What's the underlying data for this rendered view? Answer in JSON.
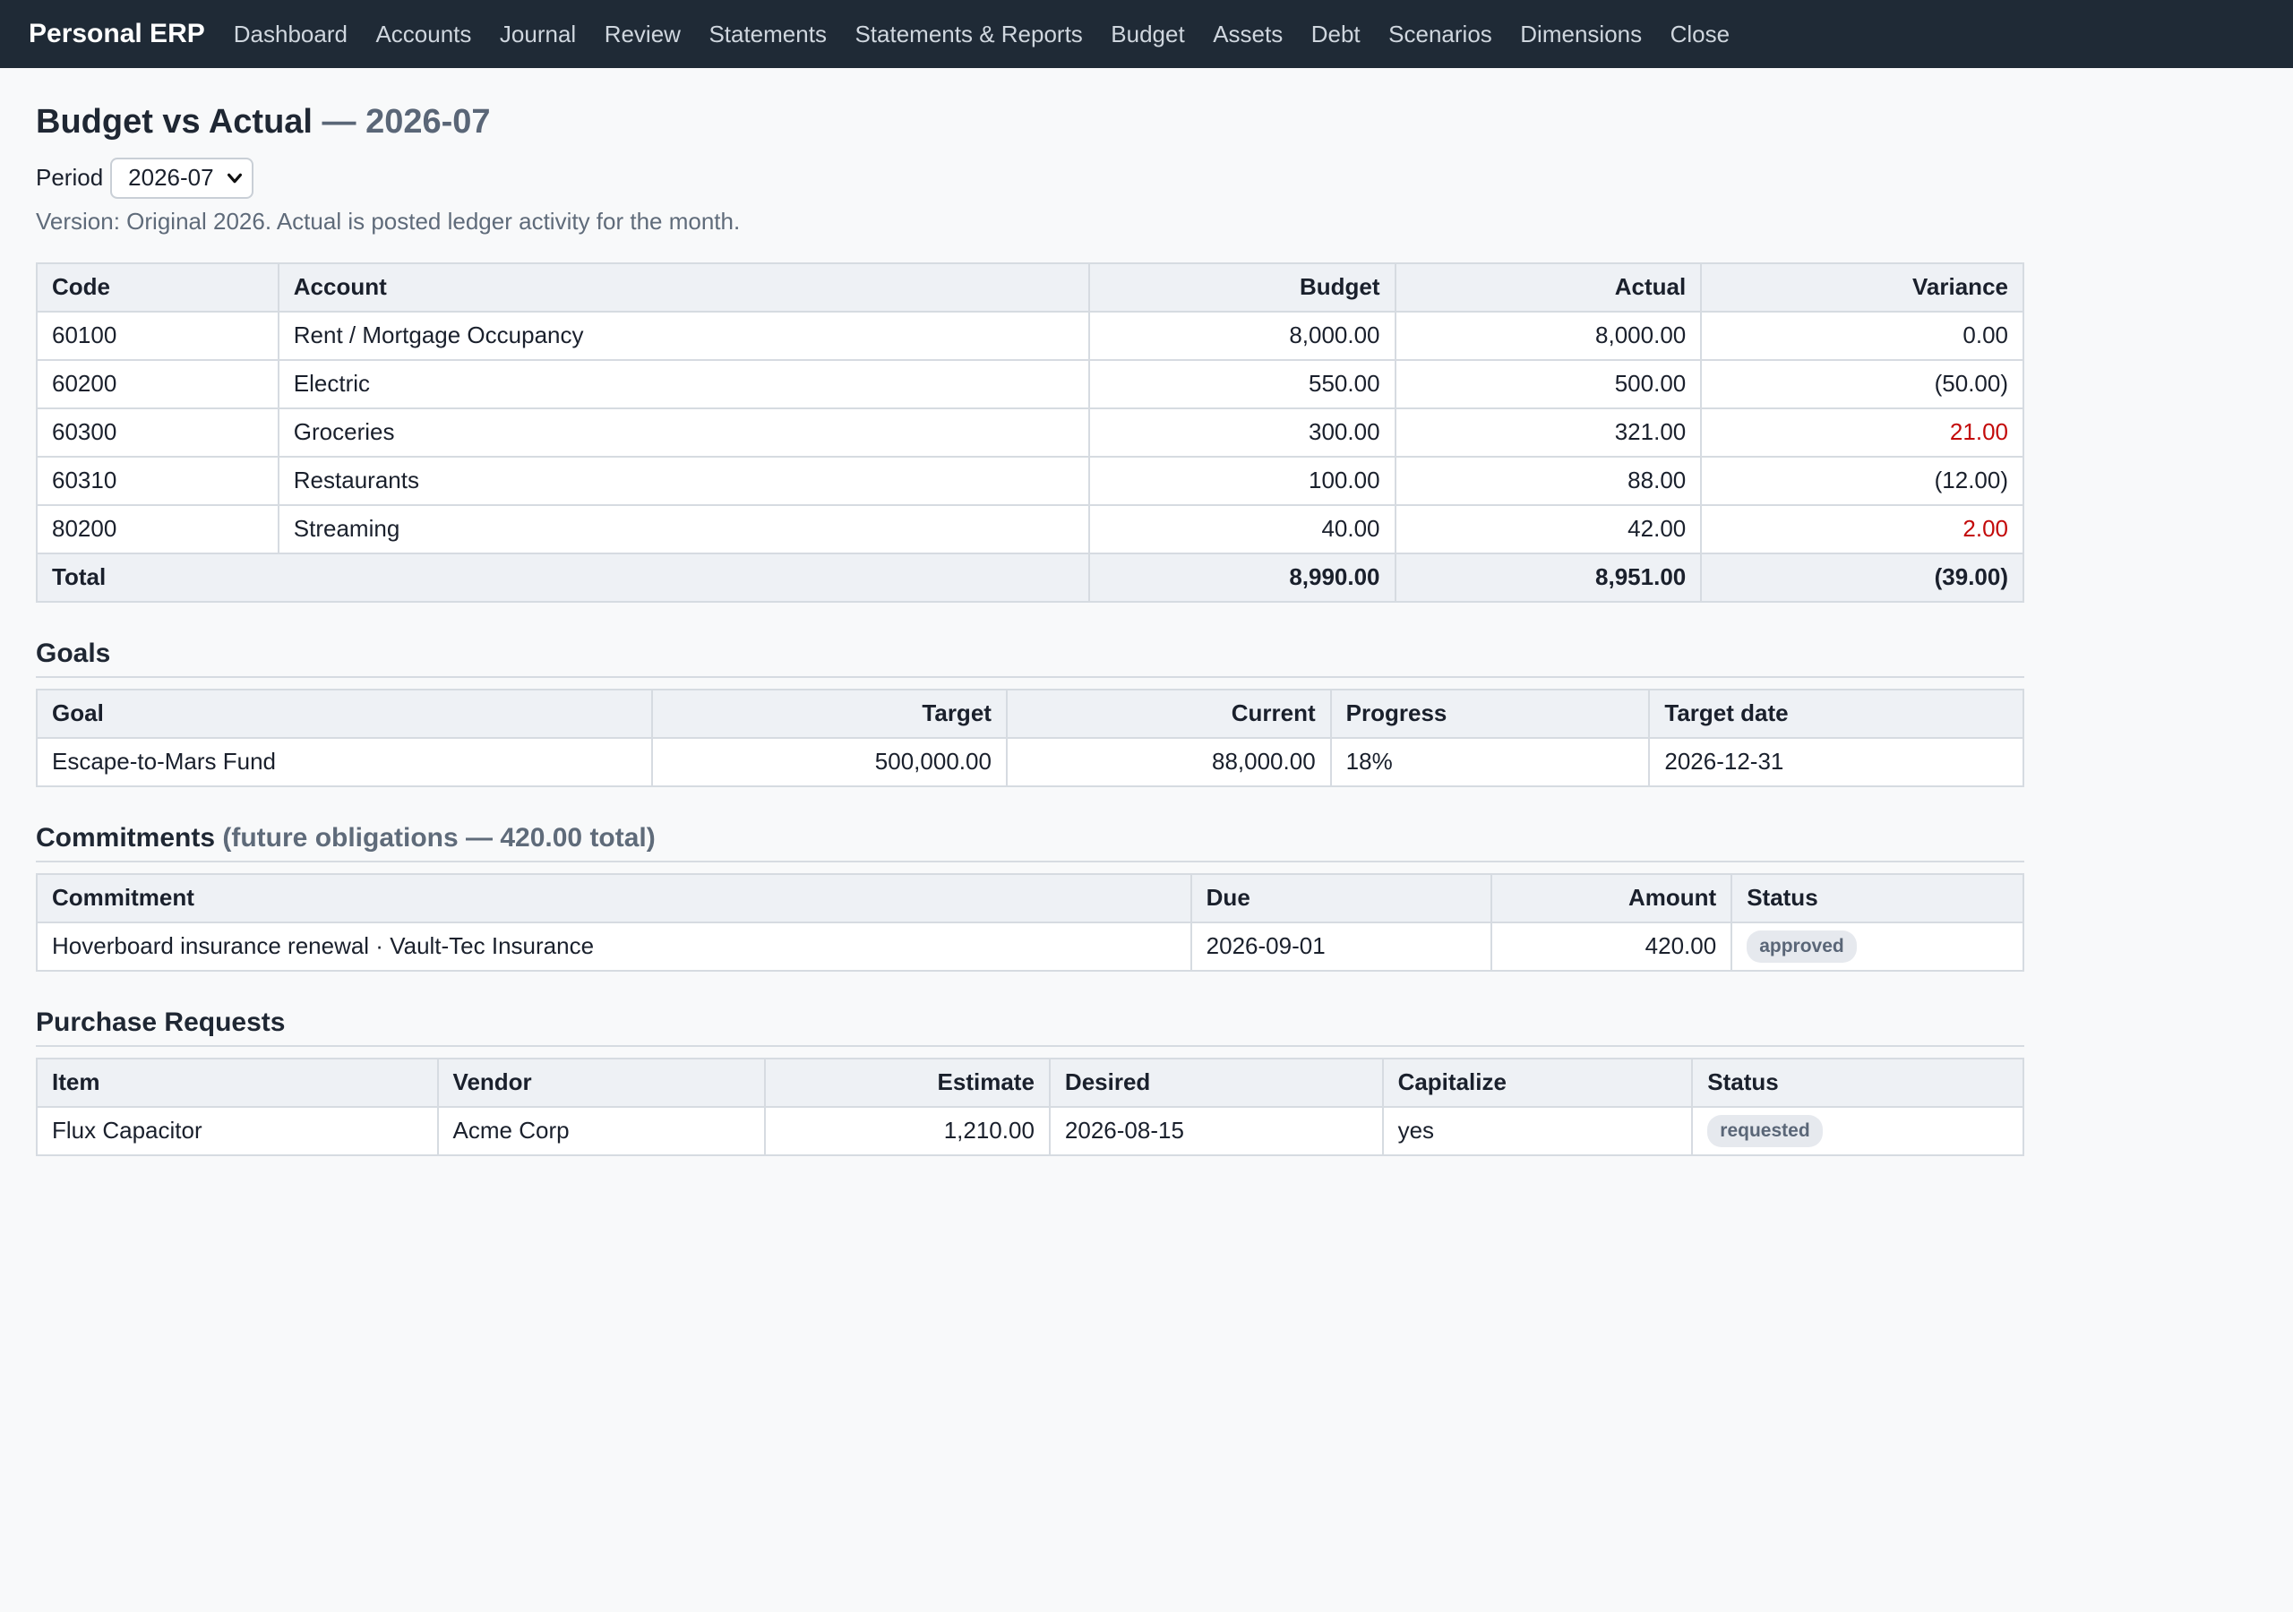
{
  "nav": {
    "brand": "Personal ERP",
    "items": [
      "Dashboard",
      "Accounts",
      "Journal",
      "Review",
      "Statements",
      "Statements & Reports",
      "Budget",
      "Assets",
      "Debt",
      "Scenarios",
      "Dimensions",
      "Close"
    ]
  },
  "page": {
    "title": "Budget vs Actual",
    "title_sep": "—",
    "title_period": "2026-07",
    "period_label": "Period",
    "period_value": "2026-07",
    "note": "Version: Original 2026. Actual is posted ledger activity for the month."
  },
  "budget_table": {
    "headers": {
      "code": "Code",
      "account": "Account",
      "budget": "Budget",
      "actual": "Actual",
      "variance": "Variance"
    },
    "rows": [
      {
        "code": "60100",
        "account": "Rent / Mortgage Occupancy",
        "budget": "8,000.00",
        "actual": "8,000.00",
        "variance": "0.00",
        "variance_color": "#1a202c"
      },
      {
        "code": "60200",
        "account": "Electric",
        "budget": "550.00",
        "actual": "500.00",
        "variance": "(50.00)",
        "variance_color": "#1a202c"
      },
      {
        "code": "60300",
        "account": "Groceries",
        "budget": "300.00",
        "actual": "321.00",
        "variance": "21.00",
        "variance_color": "#c30a0a"
      },
      {
        "code": "60310",
        "account": "Restaurants",
        "budget": "100.00",
        "actual": "88.00",
        "variance": "(12.00)",
        "variance_color": "#1a202c"
      },
      {
        "code": "80200",
        "account": "Streaming",
        "budget": "40.00",
        "actual": "42.00",
        "variance": "2.00",
        "variance_color": "#c30a0a"
      }
    ],
    "total": {
      "label": "Total",
      "budget": "8,990.00",
      "actual": "8,951.00",
      "variance": "(39.00)"
    }
  },
  "goals": {
    "heading": "Goals",
    "headers": {
      "goal": "Goal",
      "target": "Target",
      "current": "Current",
      "progress": "Progress",
      "target_date": "Target date"
    },
    "rows": [
      {
        "goal": "Escape-to-Mars Fund",
        "target": "500,000.00",
        "current": "88,000.00",
        "progress": "18%",
        "target_date": "2026-12-31"
      }
    ]
  },
  "commitments": {
    "heading": "Commitments",
    "subheading": "(future obligations — 420.00 total)",
    "headers": {
      "commitment": "Commitment",
      "due": "Due",
      "amount": "Amount",
      "status": "Status"
    },
    "rows": [
      {
        "commitment": "Hoverboard insurance renewal · Vault-Tec Insurance",
        "due": "2026-09-01",
        "amount": "420.00",
        "status": "approved"
      }
    ]
  },
  "purchase_requests": {
    "heading": "Purchase Requests",
    "headers": {
      "item": "Item",
      "vendor": "Vendor",
      "estimate": "Estimate",
      "desired": "Desired",
      "capitalize": "Capitalize",
      "status": "Status"
    },
    "rows": [
      {
        "item": "Flux Capacitor",
        "vendor": "Acme Corp",
        "estimate": "1,210.00",
        "desired": "2026-08-15",
        "capitalize": "yes",
        "status": "requested"
      }
    ]
  },
  "colors": {
    "topbar": "#1f2a36",
    "negative_variance": "#c30a0a",
    "badge_bg": "#e6e9ee"
  }
}
